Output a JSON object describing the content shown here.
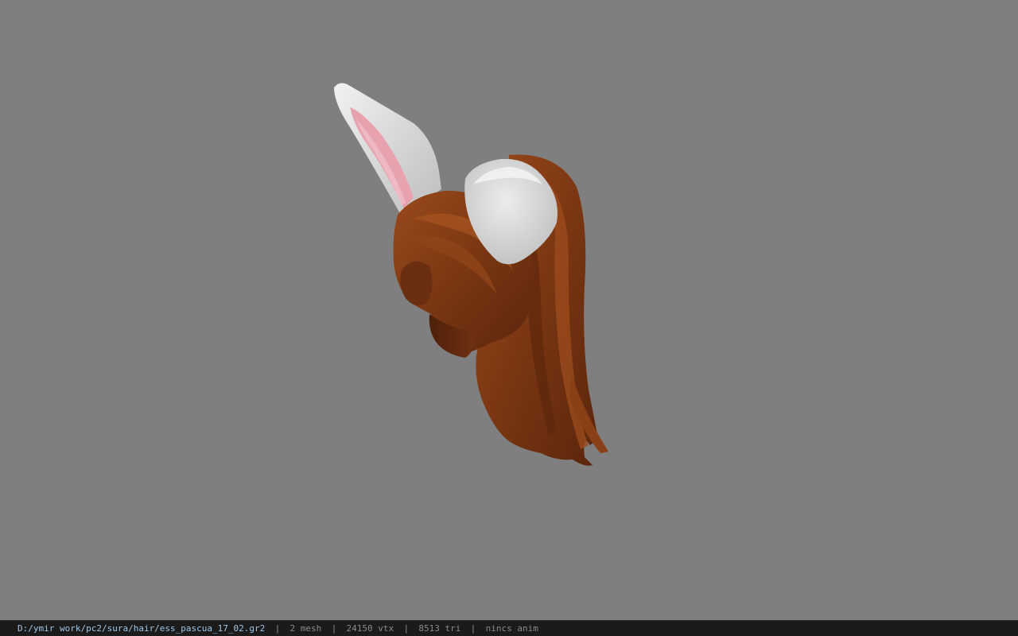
{
  "viewer": {
    "background_color": "#7f7f7f",
    "model": {
      "name": "bunny-ears-hair-model",
      "hair_color": "#7a3a14",
      "ear_outer_color": "#e2e2e2",
      "ear_inner_color": "#e7a2ae"
    }
  },
  "statusbar": {
    "file_path": "D:/ymir work/pc2/sura/hair/ess_pascua_17_02.gr2",
    "separator": "|",
    "mesh_count": "2 mesh",
    "vertex_count": "24150 vtx",
    "triangle_count": "8513 tri",
    "anim_status": "nincs anim"
  }
}
